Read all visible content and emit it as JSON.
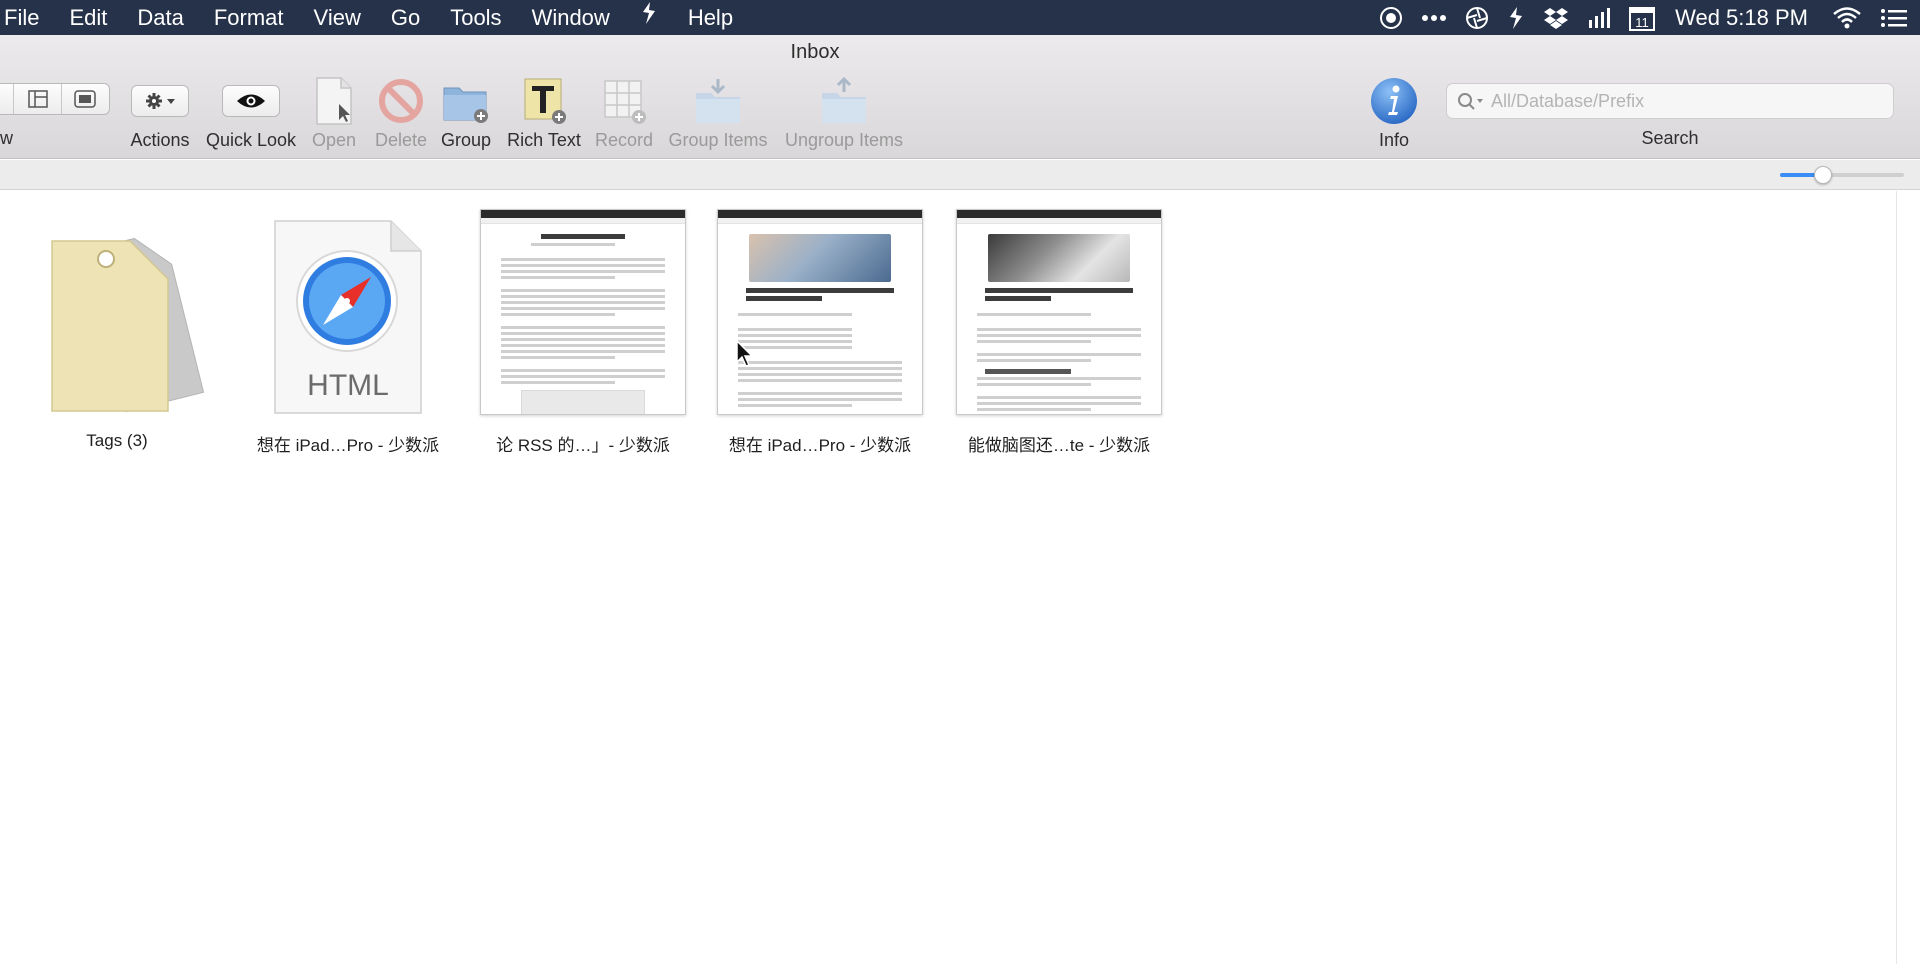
{
  "menubar": {
    "items": [
      "File",
      "Edit",
      "Data",
      "Format",
      "View",
      "Go",
      "Tools",
      "Window",
      "Help"
    ],
    "clock": "Wed 5:18 PM",
    "calendar_day": "11",
    "status_icons": [
      "record-icon",
      "more-icon",
      "aperture-icon",
      "evernote-icon",
      "dropbox-icon",
      "signal-icon",
      "calendar-icon",
      "wifi-icon",
      "list-icon"
    ]
  },
  "window": {
    "title": "Inbox"
  },
  "toolbar": {
    "view_label": "w",
    "actions_label": "Actions",
    "quicklook_label": "Quick Look",
    "open_label": "Open",
    "delete_label": "Delete",
    "group_label": "Group",
    "richtext_label": "Rich Text",
    "record_label": "Record",
    "group_items_label": "Group Items",
    "ungroup_items_label": "Ungroup Items",
    "info_label": "Info",
    "search_label": "Search",
    "search_placeholder": "All/Database/Prefix"
  },
  "zoom": {
    "value_fraction": 0.35
  },
  "items": [
    {
      "name": "Tags (3)",
      "kind": "tags"
    },
    {
      "name": "想在 iPad…Pro - 少数派",
      "kind": "html",
      "badge": "HTML"
    },
    {
      "name": "论 RSS 的…」- 少数派",
      "kind": "webarchive"
    },
    {
      "name": "想在 iPad…Pro - 少数派",
      "kind": "webarchive-image"
    },
    {
      "name": "能做脑图还…te - 少数派",
      "kind": "webarchive-image-dark"
    }
  ],
  "colors": {
    "menubar_bg": "#25324a",
    "accent": "#3a8df5",
    "tag_yellow": "#ede3b5",
    "safari_blue": "#2f7de0"
  }
}
